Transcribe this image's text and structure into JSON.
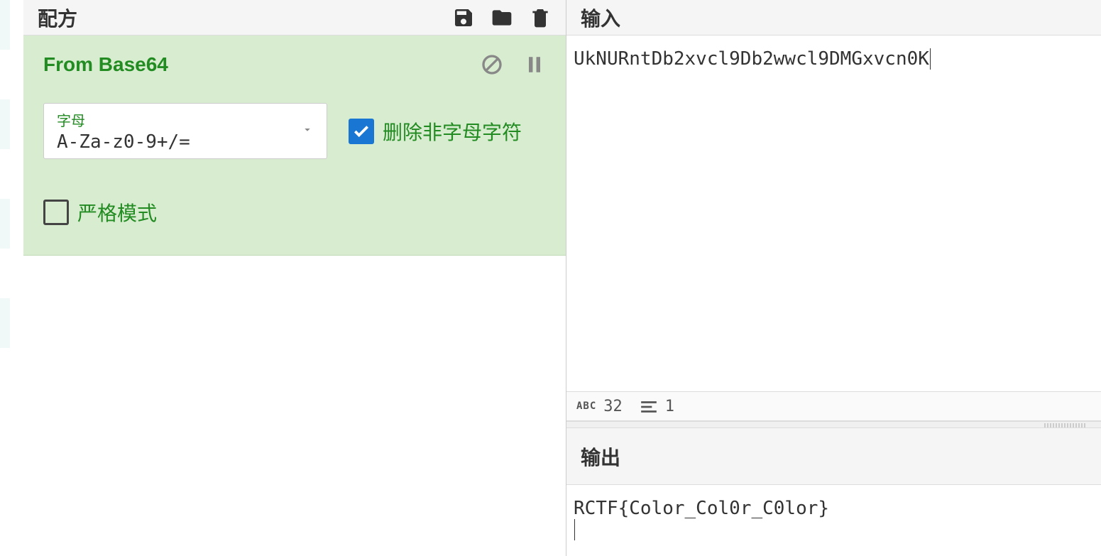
{
  "recipe": {
    "title": "配方",
    "operation": {
      "name": "From Base64",
      "alphabet_label": "字母",
      "alphabet_value": "A-Za-z0-9+/=",
      "remove_non_alpha_label": "删除非字母字符",
      "remove_non_alpha_checked": true,
      "strict_mode_label": "严格模式",
      "strict_mode_checked": false
    }
  },
  "input": {
    "title": "输入",
    "text": "UkNURntDb2xvcl9Db2wwcl9DMGxvcn0K"
  },
  "status": {
    "char_count": "32",
    "line_count": "1"
  },
  "output": {
    "title": "输出",
    "text": "RCTF{Color_Col0r_C0lor}"
  }
}
